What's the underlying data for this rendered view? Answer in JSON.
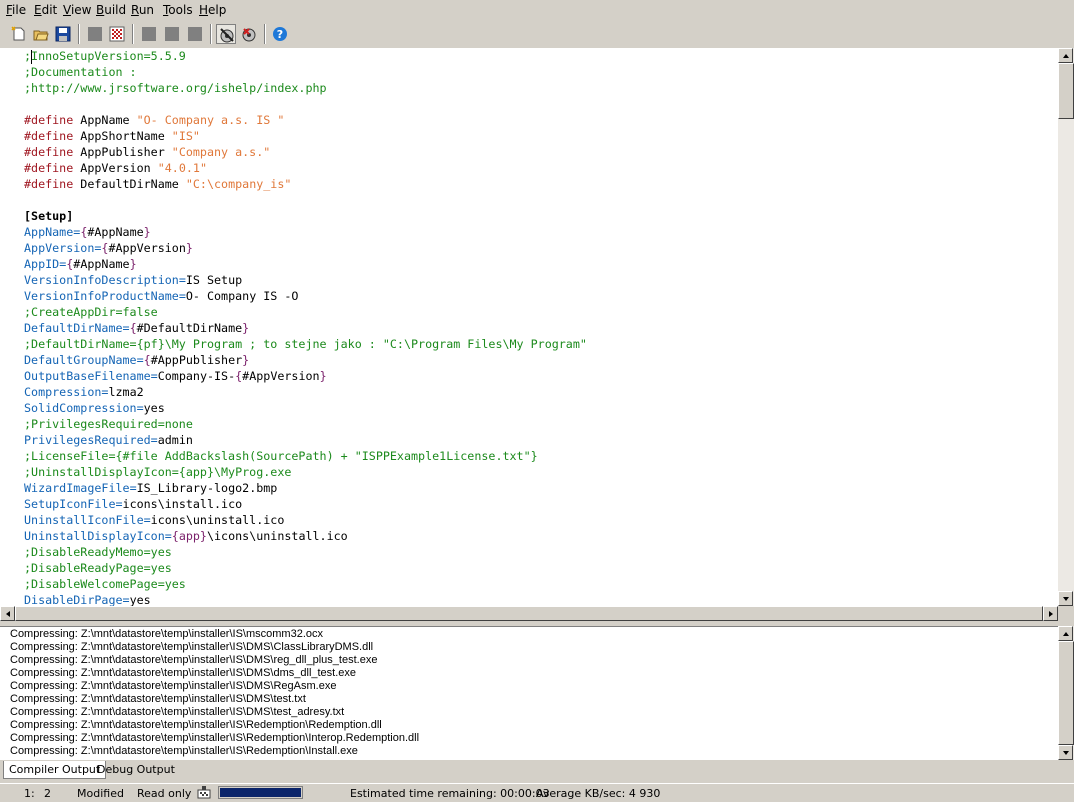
{
  "menu": [
    "File",
    "Edit",
    "View",
    "Build",
    "Run",
    "Tools",
    "Help"
  ],
  "menu_accel": [
    "F",
    "E",
    "V",
    "B",
    "R",
    "T",
    "H"
  ],
  "toolbar": {
    "icons": [
      "new-file-icon",
      "open-file-icon",
      "save-icon",
      "compile-icon",
      "stop-compile-icon",
      "run-icon",
      "pause-icon",
      "terminate-icon",
      "target-setup-icon",
      "target-uninstall-icon",
      "help-icon"
    ]
  },
  "editor": {
    "lines": [
      [
        {
          "t": ";InnoSetupVersion=5.5.9",
          "c": "comment"
        }
      ],
      [
        {
          "t": ";Documentation :",
          "c": "comment"
        }
      ],
      [
        {
          "t": ";http://www.jrsoftware.org/ishelp/index.php",
          "c": "comment"
        }
      ],
      [],
      [
        {
          "t": "#define",
          "c": "define"
        },
        {
          "t": " AppName ",
          "c": "val"
        },
        {
          "t": "\"O- Company a.s. IS \"",
          "c": "str"
        }
      ],
      [
        {
          "t": "#define",
          "c": "define"
        },
        {
          "t": " AppShortName ",
          "c": "val"
        },
        {
          "t": "\"IS\"",
          "c": "str"
        }
      ],
      [
        {
          "t": "#define",
          "c": "define"
        },
        {
          "t": " AppPublisher ",
          "c": "val"
        },
        {
          "t": "\"Company a.s.\"",
          "c": "str"
        }
      ],
      [
        {
          "t": "#define",
          "c": "define"
        },
        {
          "t": " AppVersion ",
          "c": "val"
        },
        {
          "t": "\"4.0.1\"",
          "c": "str"
        }
      ],
      [
        {
          "t": "#define",
          "c": "define"
        },
        {
          "t": " DefaultDirName ",
          "c": "val"
        },
        {
          "t": "\"C:\\company_is\"",
          "c": "str"
        }
      ],
      [],
      [
        {
          "t": "[Setup]",
          "c": "section"
        }
      ],
      [
        {
          "t": "AppName",
          "c": "key"
        },
        {
          "t": "=",
          "c": "key"
        },
        {
          "t": "{",
          "c": "brace"
        },
        {
          "t": "#AppName",
          "c": "val"
        },
        {
          "t": "}",
          "c": "brace"
        }
      ],
      [
        {
          "t": "AppVersion",
          "c": "key"
        },
        {
          "t": "=",
          "c": "key"
        },
        {
          "t": "{",
          "c": "brace"
        },
        {
          "t": "#AppVersion",
          "c": "val"
        },
        {
          "t": "}",
          "c": "brace"
        }
      ],
      [
        {
          "t": "AppID",
          "c": "key"
        },
        {
          "t": "=",
          "c": "key"
        },
        {
          "t": "{",
          "c": "brace"
        },
        {
          "t": "#AppName",
          "c": "val"
        },
        {
          "t": "}",
          "c": "brace"
        }
      ],
      [
        {
          "t": "VersionInfoDescription",
          "c": "key"
        },
        {
          "t": "=",
          "c": "key"
        },
        {
          "t": "IS Setup",
          "c": "val"
        }
      ],
      [
        {
          "t": "VersionInfoProductName",
          "c": "key"
        },
        {
          "t": "=",
          "c": "key"
        },
        {
          "t": "O- Company IS -O",
          "c": "val"
        }
      ],
      [
        {
          "t": ";CreateAppDir=false",
          "c": "comment"
        }
      ],
      [
        {
          "t": "DefaultDirName",
          "c": "key"
        },
        {
          "t": "=",
          "c": "key"
        },
        {
          "t": "{",
          "c": "brace"
        },
        {
          "t": "#DefaultDirName",
          "c": "val"
        },
        {
          "t": "}",
          "c": "brace"
        }
      ],
      [
        {
          "t": ";DefaultDirName={pf}\\My Program ; to stejne jako : \"C:\\Program Files\\My Program\"",
          "c": "comment"
        }
      ],
      [
        {
          "t": "DefaultGroupName",
          "c": "key"
        },
        {
          "t": "=",
          "c": "key"
        },
        {
          "t": "{",
          "c": "brace"
        },
        {
          "t": "#AppPublisher",
          "c": "val"
        },
        {
          "t": "}",
          "c": "brace"
        }
      ],
      [
        {
          "t": "OutputBaseFilename",
          "c": "key"
        },
        {
          "t": "=",
          "c": "key"
        },
        {
          "t": "Company-IS-",
          "c": "val"
        },
        {
          "t": "{",
          "c": "brace"
        },
        {
          "t": "#AppVersion",
          "c": "val"
        },
        {
          "t": "}",
          "c": "brace"
        }
      ],
      [
        {
          "t": "Compression",
          "c": "key"
        },
        {
          "t": "=",
          "c": "key"
        },
        {
          "t": "lzma2",
          "c": "val"
        }
      ],
      [
        {
          "t": "SolidCompression",
          "c": "key"
        },
        {
          "t": "=",
          "c": "key"
        },
        {
          "t": "yes",
          "c": "val"
        }
      ],
      [
        {
          "t": ";PrivilegesRequired=none",
          "c": "comment"
        }
      ],
      [
        {
          "t": "PrivilegesRequired",
          "c": "key"
        },
        {
          "t": "=",
          "c": "key"
        },
        {
          "t": "admin",
          "c": "val"
        }
      ],
      [
        {
          "t": ";LicenseFile={#file AddBackslash(SourcePath) + \"ISPPExample1License.txt\"}",
          "c": "comment"
        }
      ],
      [
        {
          "t": ";UninstallDisplayIcon={app}\\MyProg.exe",
          "c": "comment"
        }
      ],
      [
        {
          "t": "WizardImageFile",
          "c": "key"
        },
        {
          "t": "=",
          "c": "key"
        },
        {
          "t": "IS_Library-logo2.bmp",
          "c": "val"
        }
      ],
      [
        {
          "t": "SetupIconFile",
          "c": "key"
        },
        {
          "t": "=",
          "c": "key"
        },
        {
          "t": "icons\\install.ico",
          "c": "val"
        }
      ],
      [
        {
          "t": "UninstallIconFile",
          "c": "key"
        },
        {
          "t": "=",
          "c": "key"
        },
        {
          "t": "icons\\uninstall.ico",
          "c": "val"
        }
      ],
      [
        {
          "t": "UninstallDisplayIcon",
          "c": "key"
        },
        {
          "t": "=",
          "c": "key"
        },
        {
          "t": "{app}",
          "c": "brace"
        },
        {
          "t": "\\icons\\uninstall.ico",
          "c": "val"
        }
      ],
      [
        {
          "t": ";DisableReadyMemo=yes",
          "c": "comment"
        }
      ],
      [
        {
          "t": ";DisableReadyPage=yes",
          "c": "comment"
        }
      ],
      [
        {
          "t": ";DisableWelcomePage=yes",
          "c": "comment"
        }
      ],
      [
        {
          "t": "DisableDirPage",
          "c": "key"
        },
        {
          "t": "=",
          "c": "key"
        },
        {
          "t": "yes",
          "c": "val"
        }
      ]
    ]
  },
  "output": {
    "lines": [
      "Compressing: Z:\\mnt\\datastore\\temp\\installer\\IS\\mscomm32.ocx",
      "Compressing: Z:\\mnt\\datastore\\temp\\installer\\IS\\DMS\\ClassLibraryDMS.dll",
      "Compressing: Z:\\mnt\\datastore\\temp\\installer\\IS\\DMS\\reg_dll_plus_test.exe",
      "Compressing: Z:\\mnt\\datastore\\temp\\installer\\IS\\DMS\\dms_dll_test.exe",
      "Compressing: Z:\\mnt\\datastore\\temp\\installer\\IS\\DMS\\RegAsm.exe",
      "Compressing: Z:\\mnt\\datastore\\temp\\installer\\IS\\DMS\\test.txt",
      "Compressing: Z:\\mnt\\datastore\\temp\\installer\\IS\\DMS\\test_adresy.txt",
      "Compressing: Z:\\mnt\\datastore\\temp\\installer\\IS\\Redemption\\Redemption.dll",
      "Compressing: Z:\\mnt\\datastore\\temp\\installer\\IS\\Redemption\\Interop.Redemption.dll",
      "Compressing: Z:\\mnt\\datastore\\temp\\installer\\IS\\Redemption\\Install.exe"
    ]
  },
  "tabs": [
    "Compiler Output",
    "Debug Output"
  ],
  "status": {
    "line": "1:",
    "col": "2",
    "modified": "Modified",
    "readonly": "Read only",
    "progress_fraction": 1.0,
    "eta": "Estimated time remaining: 00:00:03",
    "speed": "Average KB/sec: 4 930"
  },
  "colors": {
    "comment": "#1c8a1c",
    "key": "#1565b5",
    "define": "#a01822",
    "string": "#e0783a",
    "brace": "#7a1f6a",
    "progress": "#0a246a"
  }
}
